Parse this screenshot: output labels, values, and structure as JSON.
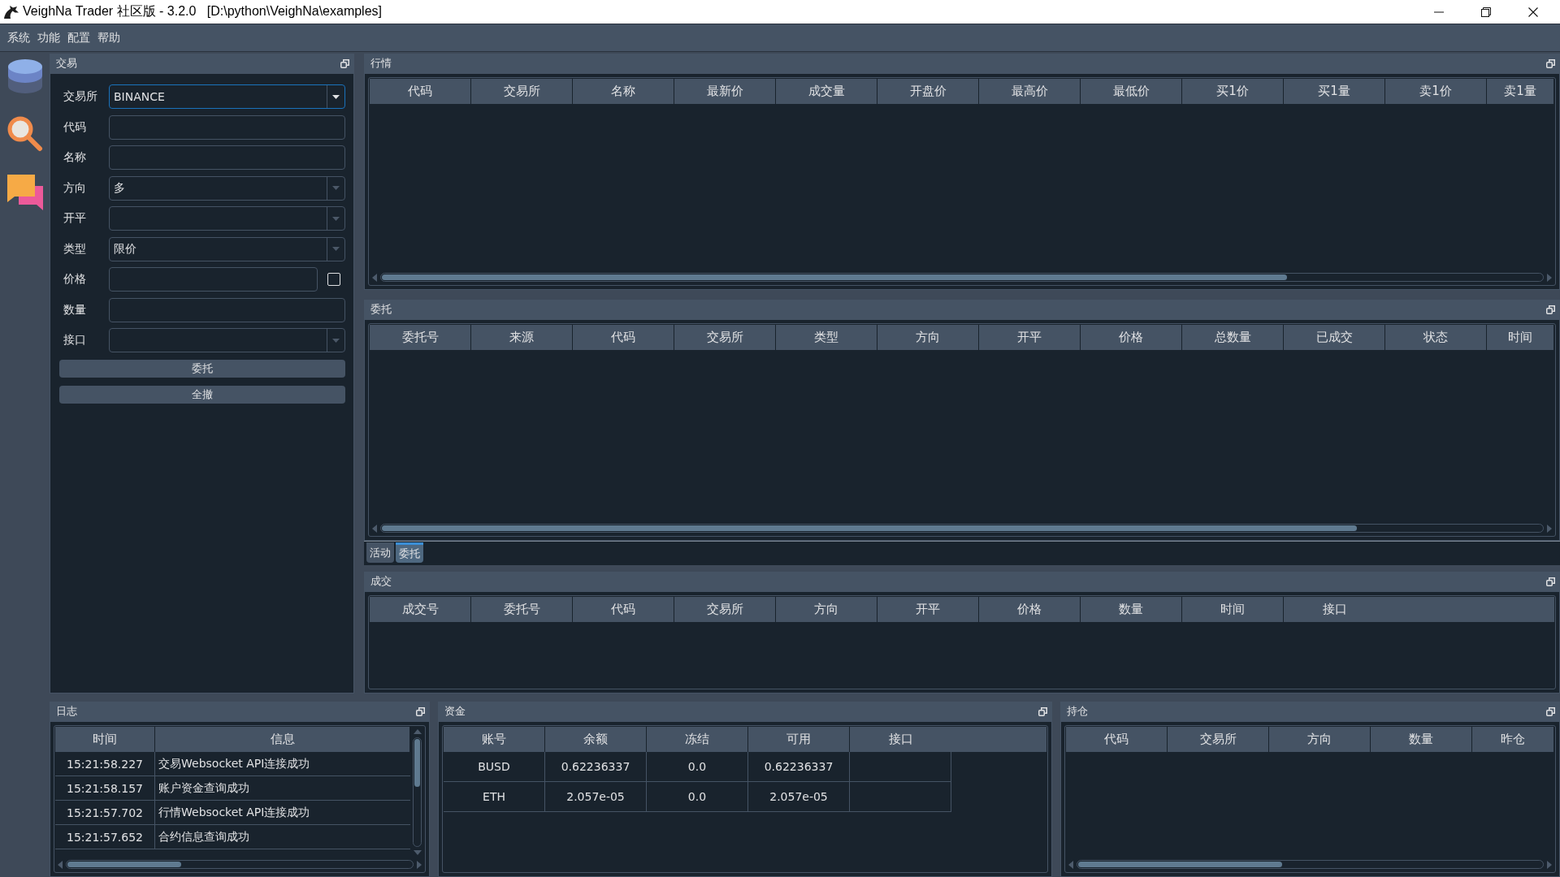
{
  "window": {
    "title": "VeighNa Trader 社区版 - 3.2.0   [D:\\python\\VeighNa\\examples]"
  },
  "menu": [
    "系统",
    "功能",
    "配置",
    "帮助"
  ],
  "trade_panel": {
    "title": "交易",
    "fields": [
      {
        "label": "交易所",
        "kind": "combo",
        "value": "BINANCE",
        "focused": true
      },
      {
        "label": "代码",
        "kind": "input",
        "focused": false
      },
      {
        "label": "名称",
        "kind": "input",
        "focused": false
      },
      {
        "label": "方向",
        "kind": "combo",
        "value": "多",
        "focused": false
      },
      {
        "label": "开平",
        "kind": "combo",
        "focused": false
      },
      {
        "label": "类型",
        "kind": "combo",
        "value": "限价",
        "focused": false
      },
      {
        "label": "价格",
        "kind": "input_check",
        "focused": false,
        "checked": false
      },
      {
        "label": "数量",
        "kind": "input",
        "focused": false
      },
      {
        "label": "接口",
        "kind": "combo",
        "focused": false
      }
    ],
    "buttons": [
      "委托",
      "全撤"
    ]
  },
  "quotes": {
    "title": "行情",
    "columns": [
      "代码",
      "交易所",
      "名称",
      "最新价",
      "成交量",
      "开盘价",
      "最高价",
      "最低价",
      "买1价",
      "买1量",
      "卖1价",
      "卖1量"
    ]
  },
  "orders": {
    "title": "委托",
    "columns": [
      "委托号",
      "来源",
      "代码",
      "交易所",
      "类型",
      "方向",
      "开平",
      "价格",
      "总数量",
      "已成交",
      "状态",
      "时间"
    ]
  },
  "tabs": [
    {
      "label": "活动",
      "selected": false
    },
    {
      "label": "委托",
      "selected": true
    }
  ],
  "trades": {
    "title": "成交",
    "columns": [
      "成交号",
      "委托号",
      "代码",
      "交易所",
      "方向",
      "开平",
      "价格",
      "数量",
      "时间",
      "接口"
    ]
  },
  "log": {
    "title": "日志",
    "columns": [
      "时间",
      "信息"
    ],
    "rows": [
      [
        "15:21:58.227",
        "交易Websocket API连接成功"
      ],
      [
        "15:21:58.157",
        "账户资金查询成功"
      ],
      [
        "15:21:57.702",
        "行情Websocket API连接成功"
      ],
      [
        "15:21:57.652",
        "合约信息查询成功"
      ]
    ]
  },
  "funds": {
    "title": "资金",
    "columns": [
      "账号",
      "余额",
      "冻结",
      "可用",
      "接口"
    ],
    "rows": [
      [
        "BUSD",
        "0.62236337",
        "0.0",
        "0.62236337"
      ],
      [
        "ETH",
        "2.057e-05",
        "0.0",
        "2.057e-05"
      ]
    ]
  },
  "positions": {
    "title": "持仓",
    "columns": [
      "代码",
      "交易所",
      "方向",
      "数量",
      "昨仓"
    ]
  }
}
